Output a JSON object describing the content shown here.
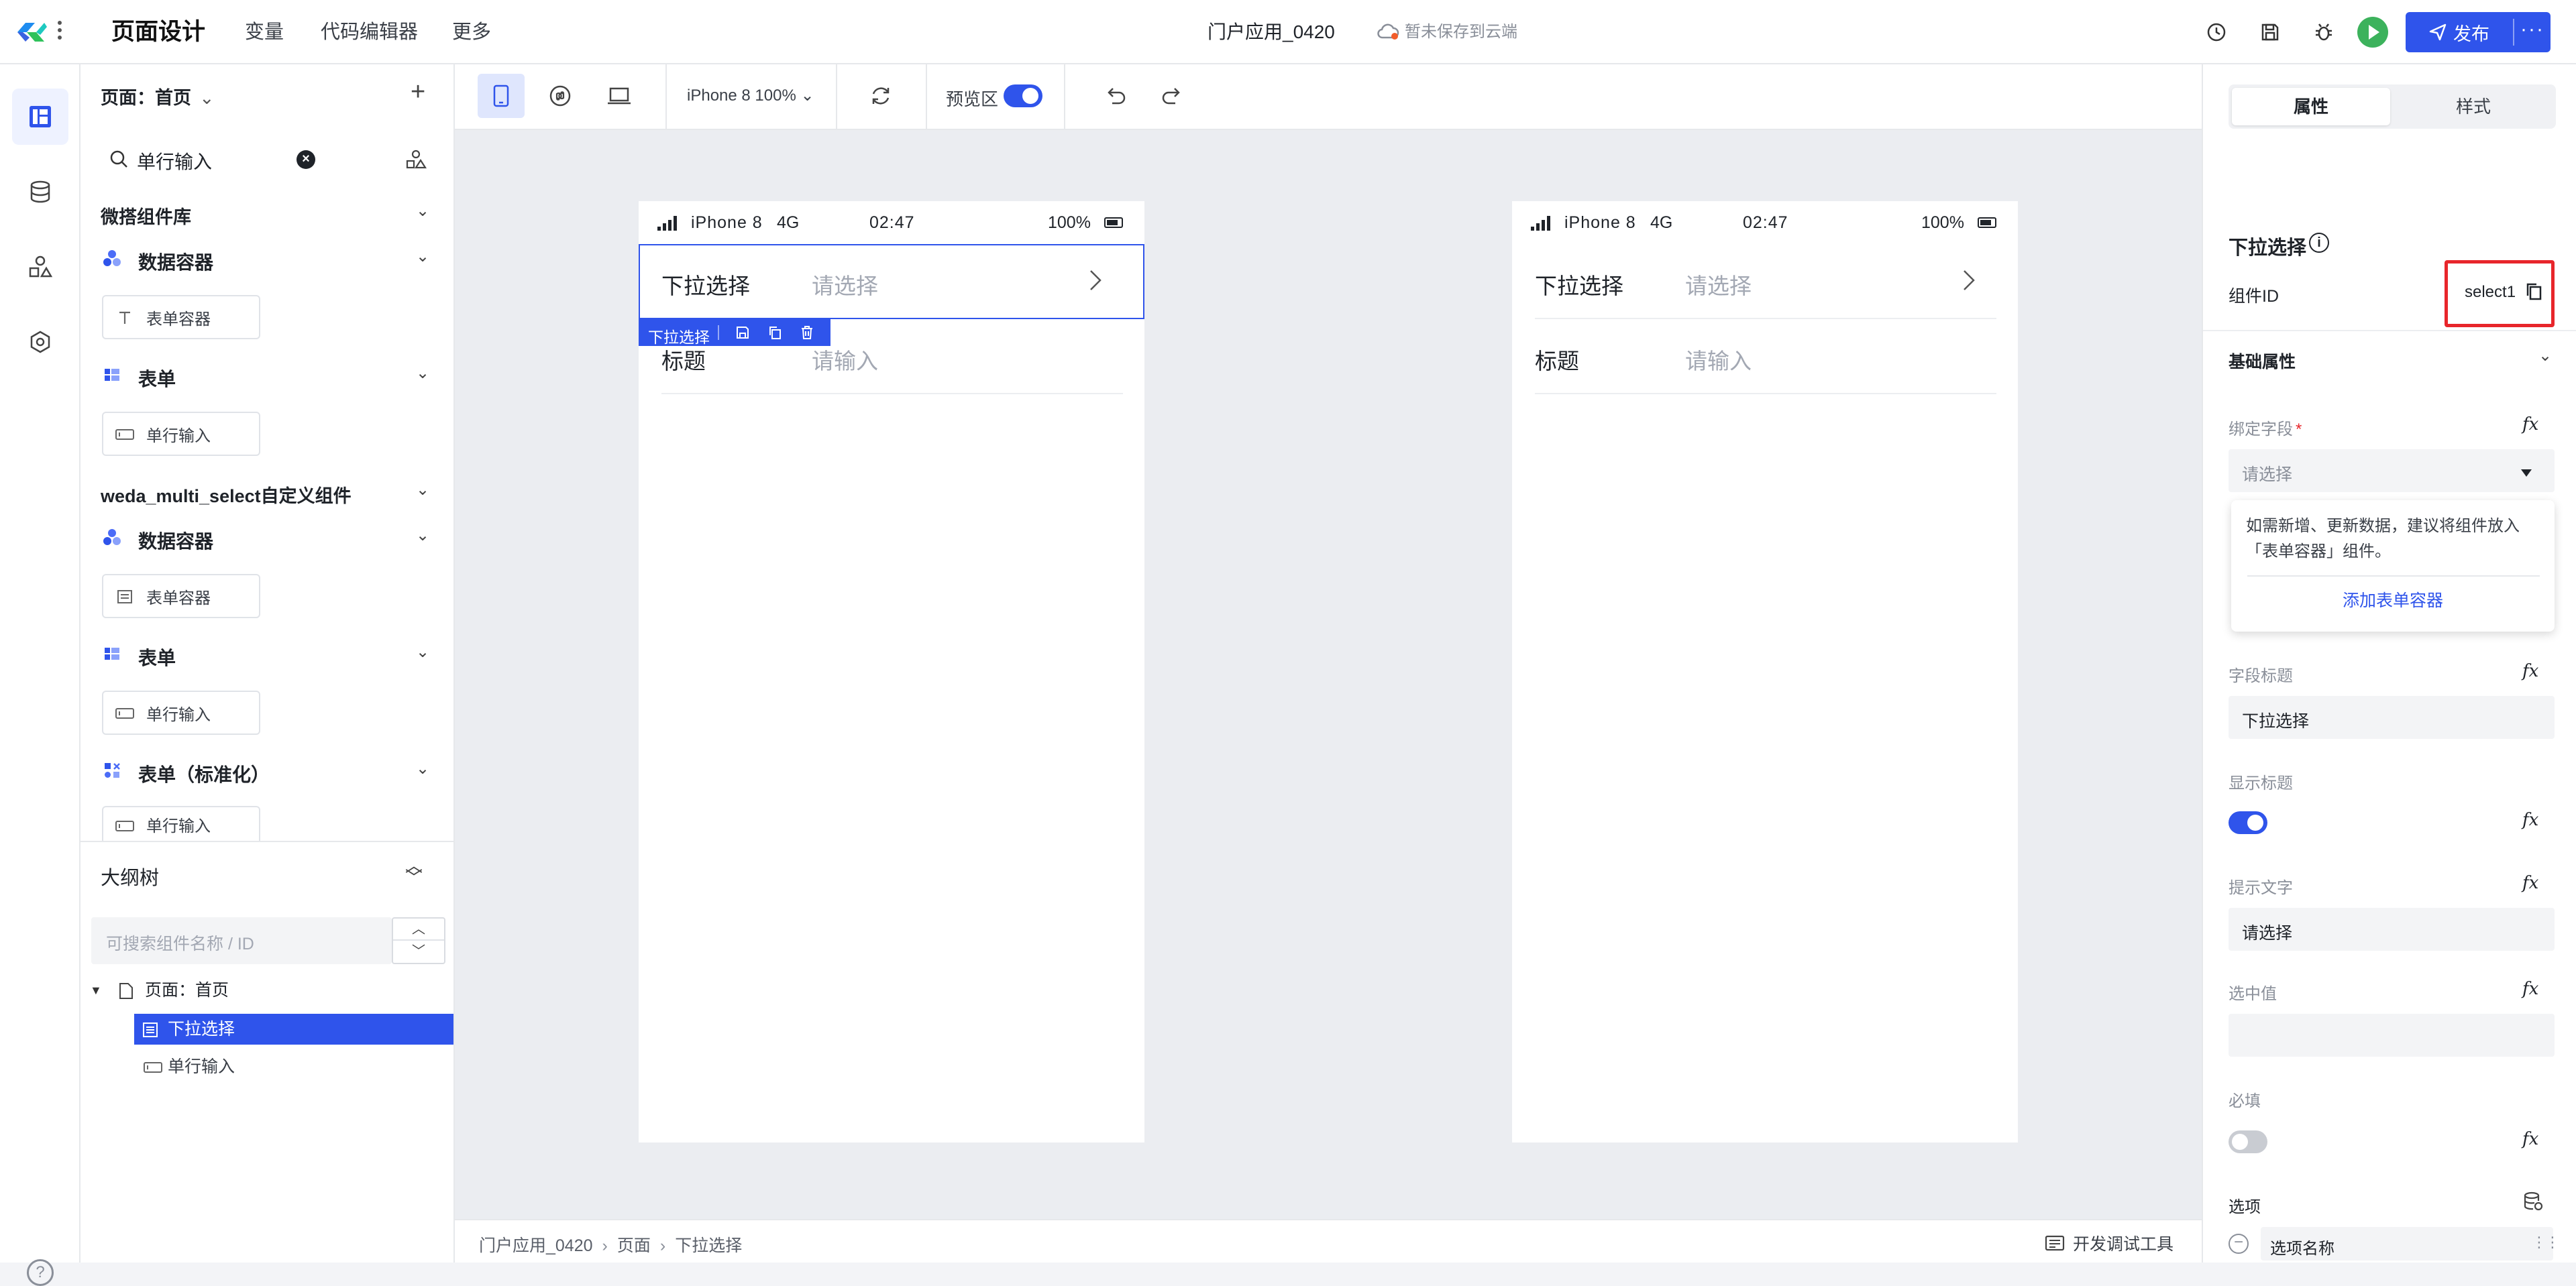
{
  "header": {
    "title": "页面设计",
    "nav": [
      "变量",
      "代码编辑器",
      "更多"
    ],
    "app_name": "门户应用_0420",
    "save_status": "暂未保存到云端",
    "publish_label": "发布",
    "publish_more": "···"
  },
  "panel": {
    "page_label": "页面：首页",
    "add_symbol": "+",
    "search_value": "单行输入",
    "libraries": [
      {
        "title": "微搭组件库",
        "groups": [
          {
            "title": "数据容器",
            "item": "表单容器"
          },
          {
            "title": "表单",
            "item": "单行输入"
          }
        ]
      },
      {
        "title": "weda_multi_select自定义组件",
        "groups": [
          {
            "title": "数据容器",
            "item": "表单容器"
          },
          {
            "title": "表单",
            "item": "单行输入"
          },
          {
            "title": "表单（标准化）",
            "item": "单行输入"
          }
        ]
      }
    ]
  },
  "outline": {
    "title": "大纲树",
    "search_placeholder": "可搜索组件名称 / ID",
    "page": "页面：首页",
    "items": [
      "下拉选择",
      "单行输入"
    ]
  },
  "toolbar": {
    "device": "iPhone 8 100%",
    "preview_label": "预览区",
    "preview_on": true
  },
  "phone": {
    "status": {
      "device": "iPhone 8",
      "network": "4G",
      "time": "02:47",
      "battery": "100%"
    },
    "fields": [
      {
        "label": "下拉选择",
        "placeholder": "请选择"
      },
      {
        "label": "标题",
        "placeholder": "请输入"
      }
    ],
    "selected_tag": "下拉选择"
  },
  "breadcrumb": [
    "门户应用_0420",
    "页面",
    "下拉选择"
  ],
  "debug_tools": "开发调试工具",
  "props": {
    "tabs": [
      "属性",
      "样式"
    ],
    "active_tab": 0,
    "component_title": "下拉选择",
    "id_label": "组件ID",
    "id_value": "select1",
    "section": "基础属性",
    "bind_field": {
      "label": "绑定字段",
      "required": "*",
      "placeholder": "请选择"
    },
    "tip": {
      "text": "如需新增、更新数据，建议将组件放入「表单容器」组件。",
      "link": "添加表单容器"
    },
    "field_title": {
      "label": "字段标题",
      "value": "下拉选择"
    },
    "show_title": {
      "label": "显示标题",
      "on": true
    },
    "hint_text": {
      "label": "提示文字",
      "value": "请选择"
    },
    "selected_value": {
      "label": "选中值",
      "value": ""
    },
    "required": {
      "label": "必填",
      "on": false
    },
    "options": {
      "label": "选项",
      "row_label": "选项名称"
    },
    "fx": "fx"
  },
  "colors": {
    "accent": "#2f54eb",
    "highlight_box": "#e8262b",
    "run_button": "#3cb25c"
  }
}
